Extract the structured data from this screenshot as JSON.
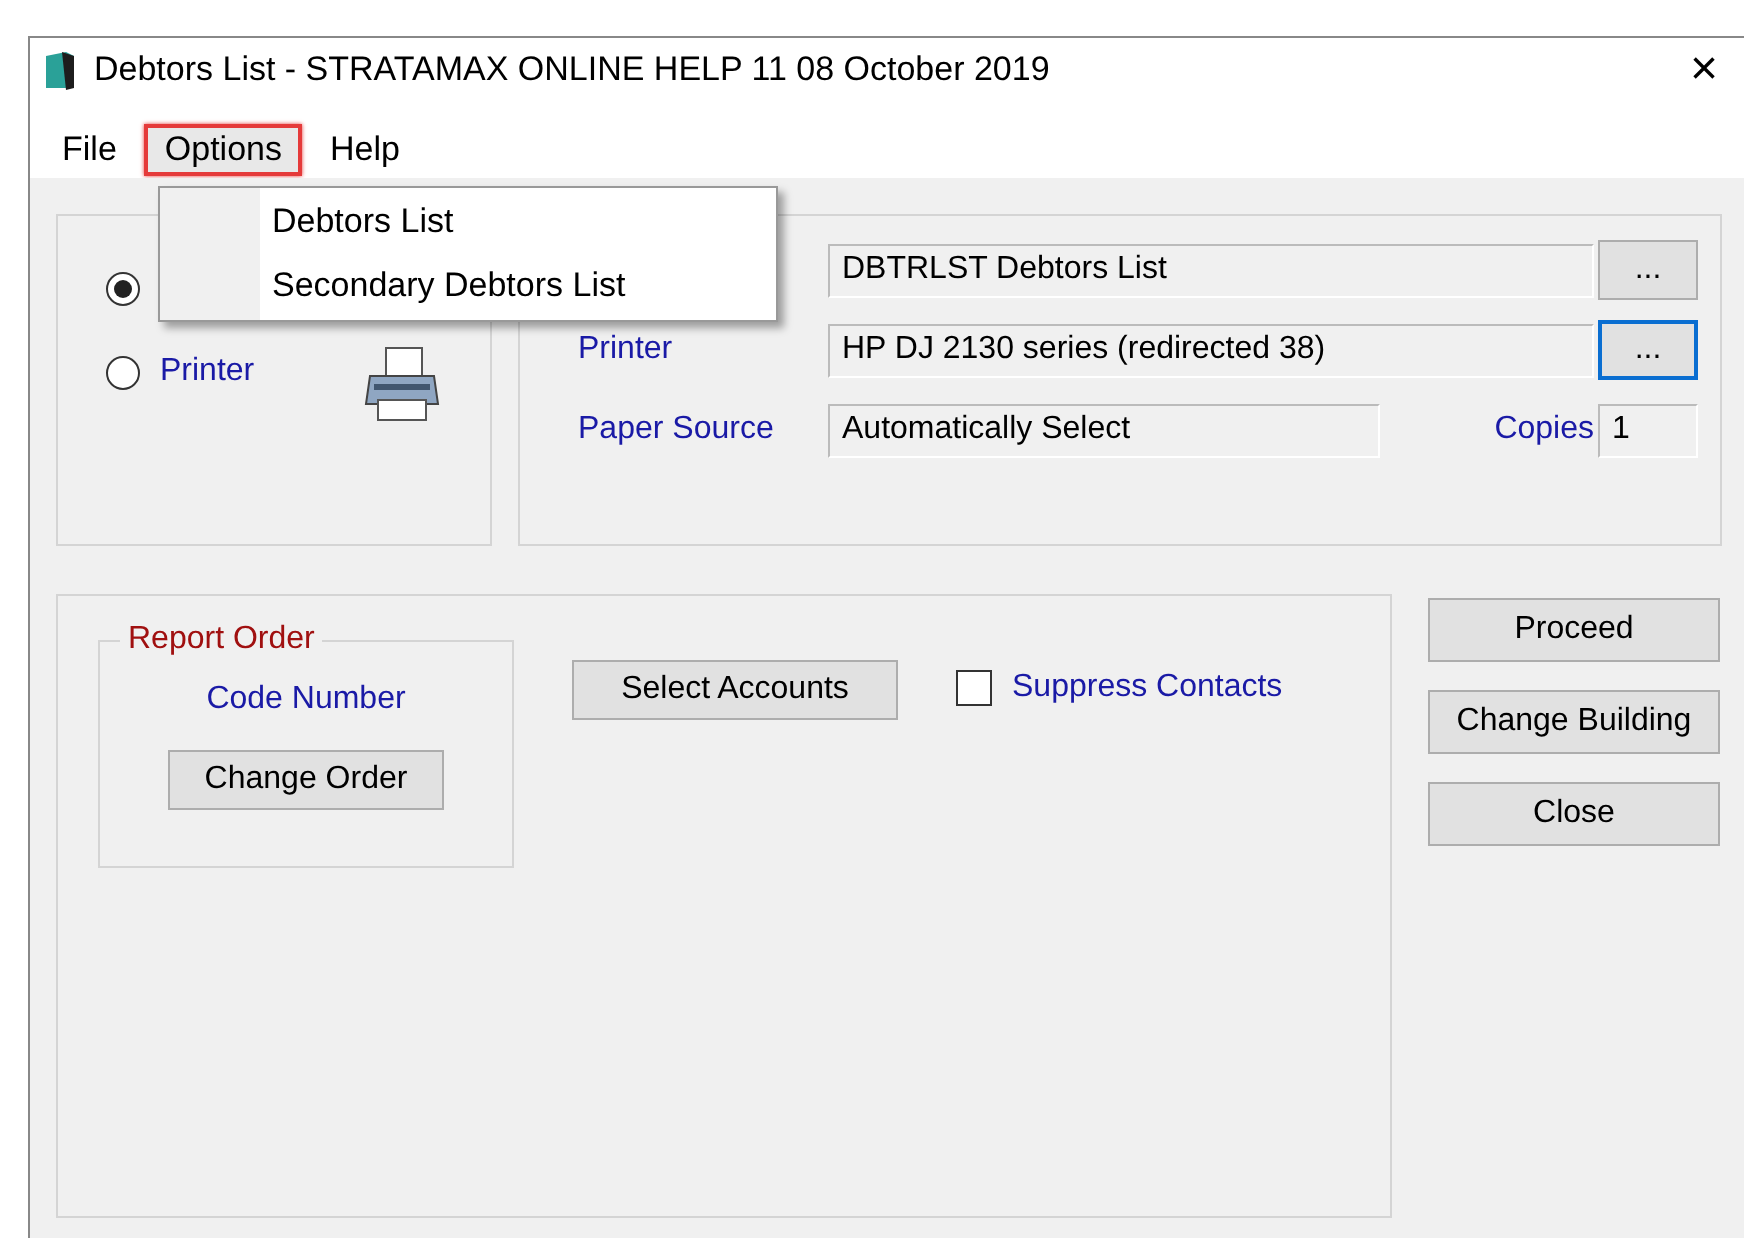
{
  "window": {
    "title": "Debtors List - STRATAMAX ONLINE HELP 11 08 October 2019",
    "close": "×"
  },
  "menu": [
    {
      "label": "File",
      "selected": false
    },
    {
      "label": "Options",
      "selected": true
    },
    {
      "label": "Help",
      "selected": false
    }
  ],
  "dropdown": [
    "Debtors List",
    "Secondary Debtors List"
  ],
  "output": [
    {
      "selected": true
    },
    {
      "label": "Printer",
      "selected": false
    }
  ],
  "settings": {
    "report": "DBTRLST Debtors List",
    "printer_label": "Printer",
    "printer": "HP DJ 2130 series (redirected 38)",
    "browse": "...",
    "paper_label": "Paper Source",
    "paper": "Automatically Select",
    "copies_label": "Copies",
    "copies": "1"
  },
  "report_order": {
    "legend": "Report Order",
    "order": "Code Number",
    "button": "Change Order"
  },
  "select_accounts": "Select Accounts",
  "suppress_contacts": {
    "label": "Suppress Contacts",
    "checked": false
  },
  "actions": [
    "Proceed",
    "Change Building",
    "Close"
  ]
}
